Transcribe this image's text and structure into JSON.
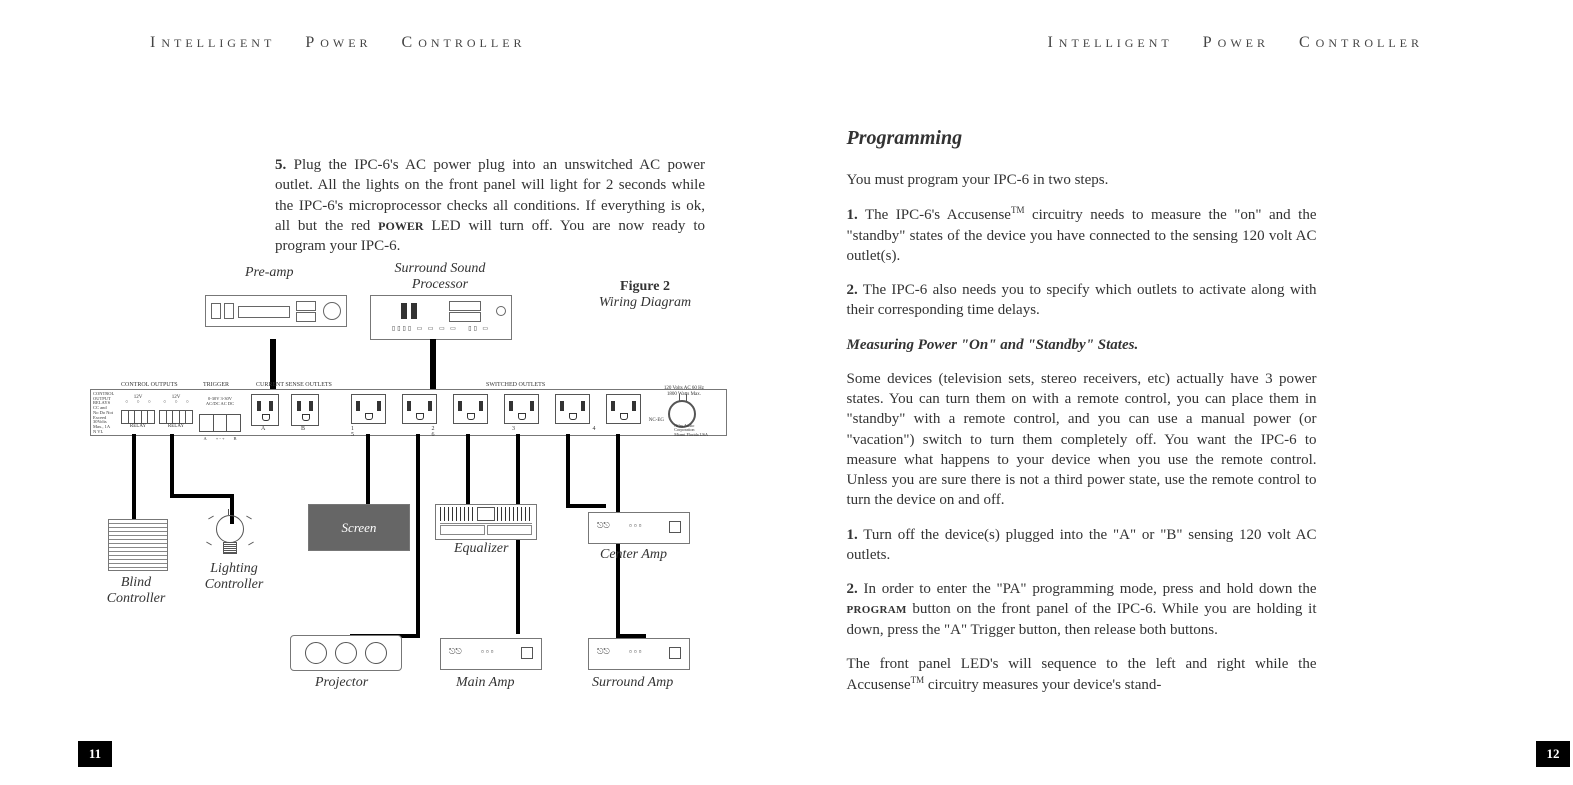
{
  "header": {
    "left": {
      "big": "I",
      "word1": "NTELLIGENT",
      "big2": "P",
      "word2": "OWER",
      "big3": "C",
      "word3": "ONTROLLER"
    },
    "right": {
      "big": "I",
      "word1": "NTELLIGENT",
      "big2": "P",
      "word2": "OWER",
      "big3": "C",
      "word3": "ONTROLLER"
    }
  },
  "leftPage": {
    "step5_num": "5.",
    "step5_text_a": " Plug the IPC-6's AC power plug into an unswitched AC power outlet.  All the lights on the front panel will light for 2 seconds while the IPC-6's microprocessor checks all conditions. If everything is ok, all but the red ",
    "step5_power": "POWER",
    "step5_text_b": " LED will turn off.  You are now ready to program your IPC-6.",
    "figure": {
      "caption_bold": "Figure 2",
      "caption_italic": "Wiring Diagram",
      "labels": {
        "preamp": "Pre-amp",
        "ssproc_a": "Surround Sound",
        "ssproc_b": "Processor",
        "blind_a": "Blind",
        "blind_b": "Controller",
        "lighting_a": "Lighting",
        "lighting_b": "Controller",
        "screen": "Screen",
        "equalizer": "Equalizer",
        "centeramp": "Center Amp",
        "projector": "Projector",
        "mainamp": "Main Amp",
        "surroundamp": "Surround Amp"
      },
      "panel_text": {
        "control_outputs": "CONTROL OUTPUTS",
        "trigger": "TRIGGER",
        "current_sense": "CURRENT SENSE OUTLETS",
        "switched": "SWITCHED OUTLETS",
        "rating": "120 Volts AC  60 Hz\n1800 Watts Max.",
        "control_relays": "CONTROL\nOUTPUT\nRELAYS\nCC and\nNo Do Not\nExceed\n30Volts\nMax., 1A\nN VL",
        "relay1_top": "12V",
        "relay1_bot": "NC PRF",
        "relay2_top": "12V",
        "relay2_bot": "NC PRF",
        "relay_label": "RELAY",
        "a": "A",
        "b": "B",
        "trigger_range": "0-30V  3-30V\nAC/DC AC DC",
        "one_to_six": "1  2  3  4  5  6",
        "nc_eg": "NC-EG",
        "brand": "Niles Audio\nCorporation\nMiami Florida USA"
      }
    },
    "pageNum": "11"
  },
  "rightPage": {
    "h2": "Programming",
    "intro": "You must program your IPC-6 in two steps.",
    "step1_num": "1.",
    "step1_a": " The IPC-6's Accusense",
    "step1_tm": "TM",
    "step1_b": " circuitry needs to measure the \"on\" and the \"standby\" states of the device you have connected to the sensing 120 volt AC outlet(s).",
    "step2_num": "2.",
    "step2": " The IPC-6 also needs you to specify which outlets to activate along with their corresponding time delays.",
    "subhead": "Measuring Power \"On\" and \"Standby\" States.",
    "para3": "Some devices (television sets, stereo receivers, etc) actually have 3 power states. You can turn them on with a remote control, you can place them in \"standby\" with a remote control, and you can use a manual power (or \"vacation\") switch to turn them completely off. You want the IPC-6 to measure what happens to your device when you use the remote control. Unless you are sure there is not a third power state, use the remote control to turn the device on and off.",
    "s1_num": "1.",
    "s1": " Turn off the device(s) plugged into the \"A\" or \"B\" sensing 120 volt AC outlets.",
    "s2_num": "2.",
    "s2_a": " In order to enter the \"PA\" programming mode, press and hold down the ",
    "s2_prog": "PROGRAM",
    "s2_b": " button on the front panel of the IPC-6. While you are holding it down, press the \"A\" Trigger button, then release both buttons.",
    "foot_a": "The front panel LED's will sequence to the left and right while the Accusense",
    "foot_tm": "TM",
    "foot_b": " circuitry measures your device's stand-",
    "pageNum": "12"
  }
}
